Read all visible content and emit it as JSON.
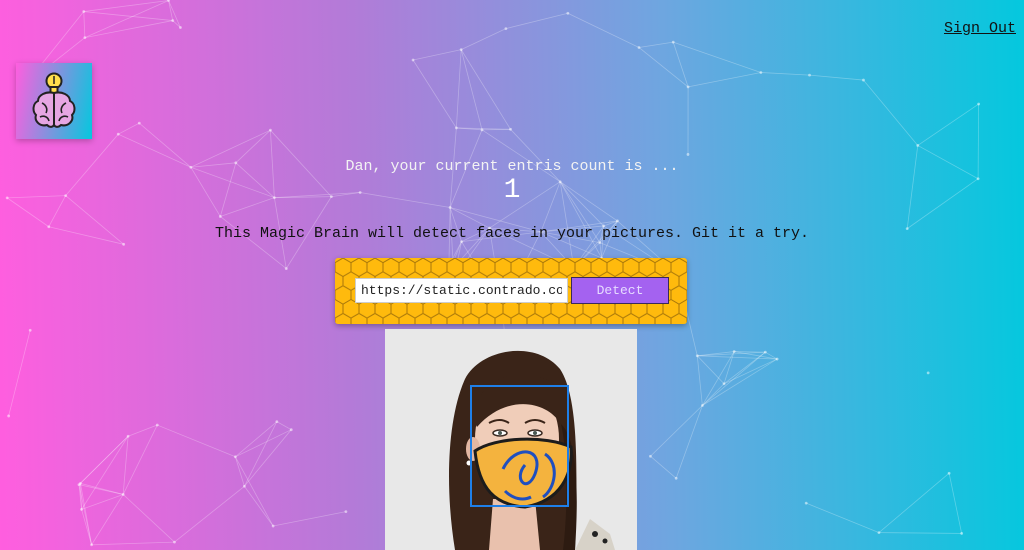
{
  "nav": {
    "sign_out_label": "Sign Out"
  },
  "logo": {
    "icon": "brain-lightbulb-icon"
  },
  "rank": {
    "message": "Dan, your current entris count is ...",
    "count": "1"
  },
  "description": "This Magic Brain will detect faces in your pictures. Git it a try.",
  "image_form": {
    "url_value": "https://static.contrado.com/",
    "detect_label": "Detect"
  },
  "face_detection": {
    "faces_detected": 1
  },
  "colors": {
    "gradient_left": "#ff5edf",
    "gradient_right": "#04c8de",
    "form_background": "#ffba0d",
    "detect_button": "#a462f0",
    "face_box": "#1e7fe8"
  }
}
